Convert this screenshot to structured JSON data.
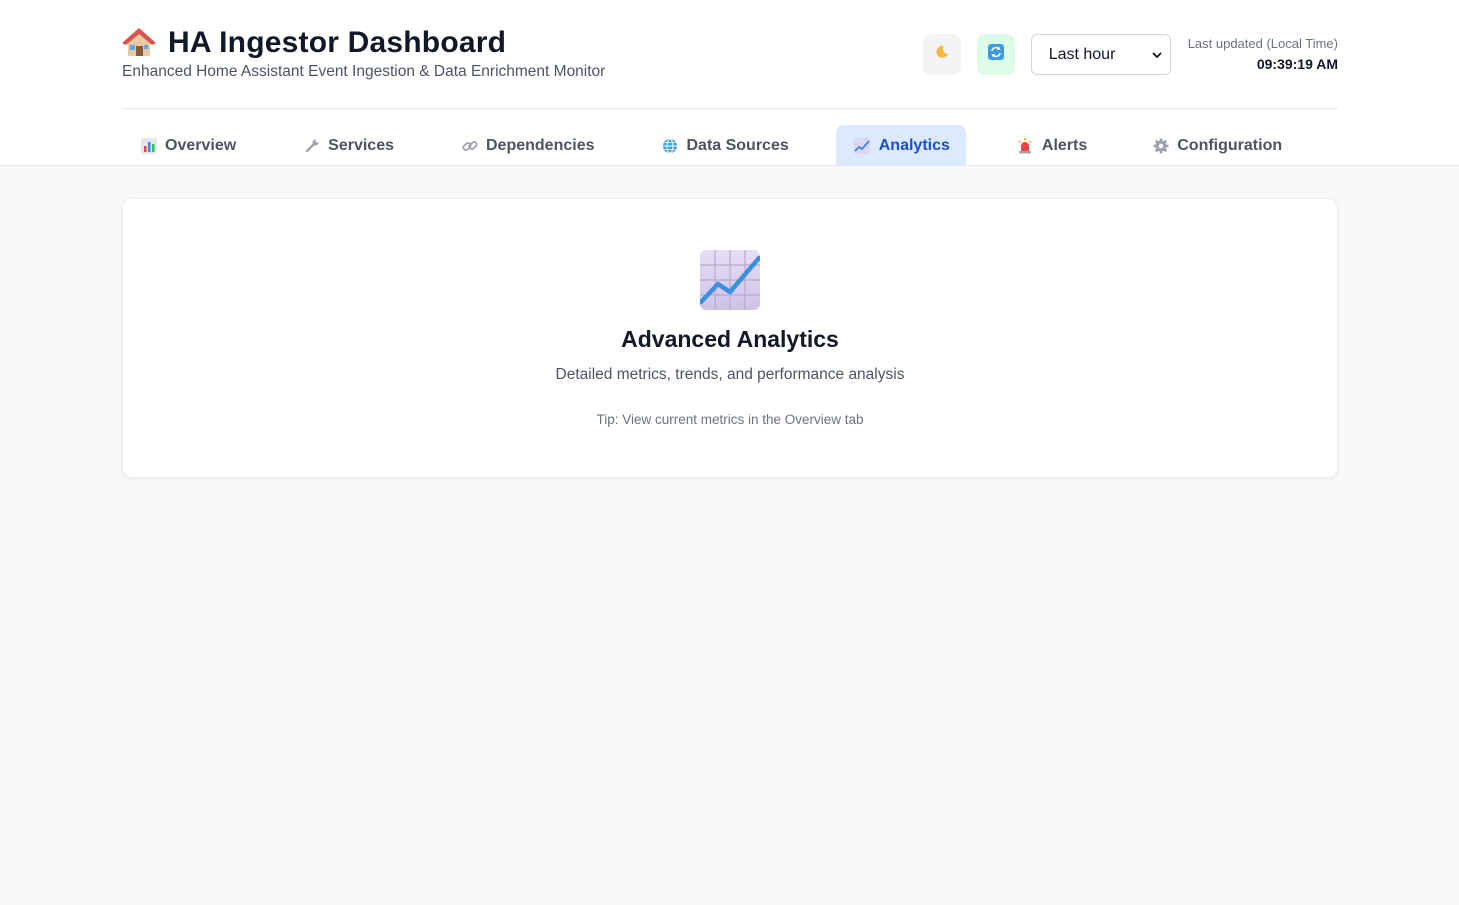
{
  "header": {
    "title": "HA Ingestor Dashboard",
    "subtitle": "Enhanced Home Assistant Event Ingestion & Data Enrichment Monitor",
    "icon": "house-icon",
    "theme_toggle_icon": "moon-icon",
    "refresh_icon": "refresh-icon",
    "time_range": {
      "selected": "Last hour"
    },
    "last_updated_label": "Last updated (Local Time)",
    "last_updated_time": "09:39:19 AM"
  },
  "tabs": [
    {
      "label": "Overview",
      "icon": "bar-chart-icon",
      "active": false
    },
    {
      "label": "Services",
      "icon": "wrench-icon",
      "active": false
    },
    {
      "label": "Dependencies",
      "icon": "link-icon",
      "active": false
    },
    {
      "label": "Data Sources",
      "icon": "globe-icon",
      "active": false
    },
    {
      "label": "Analytics",
      "icon": "trend-chart-icon",
      "active": true
    },
    {
      "label": "Alerts",
      "icon": "siren-icon",
      "active": false
    },
    {
      "label": "Configuration",
      "icon": "gear-icon",
      "active": false
    }
  ],
  "main": {
    "icon": "trend-chart-icon",
    "title": "Advanced Analytics",
    "description": "Detailed metrics, trends, and performance analysis",
    "tip": "Tip: View current metrics in the Overview tab"
  },
  "colors": {
    "accent": "#1d4ed8",
    "active_tab_bg": "#dbeafe",
    "refresh_bg": "#dcfce7",
    "page_bg": "#f8f9fb"
  }
}
